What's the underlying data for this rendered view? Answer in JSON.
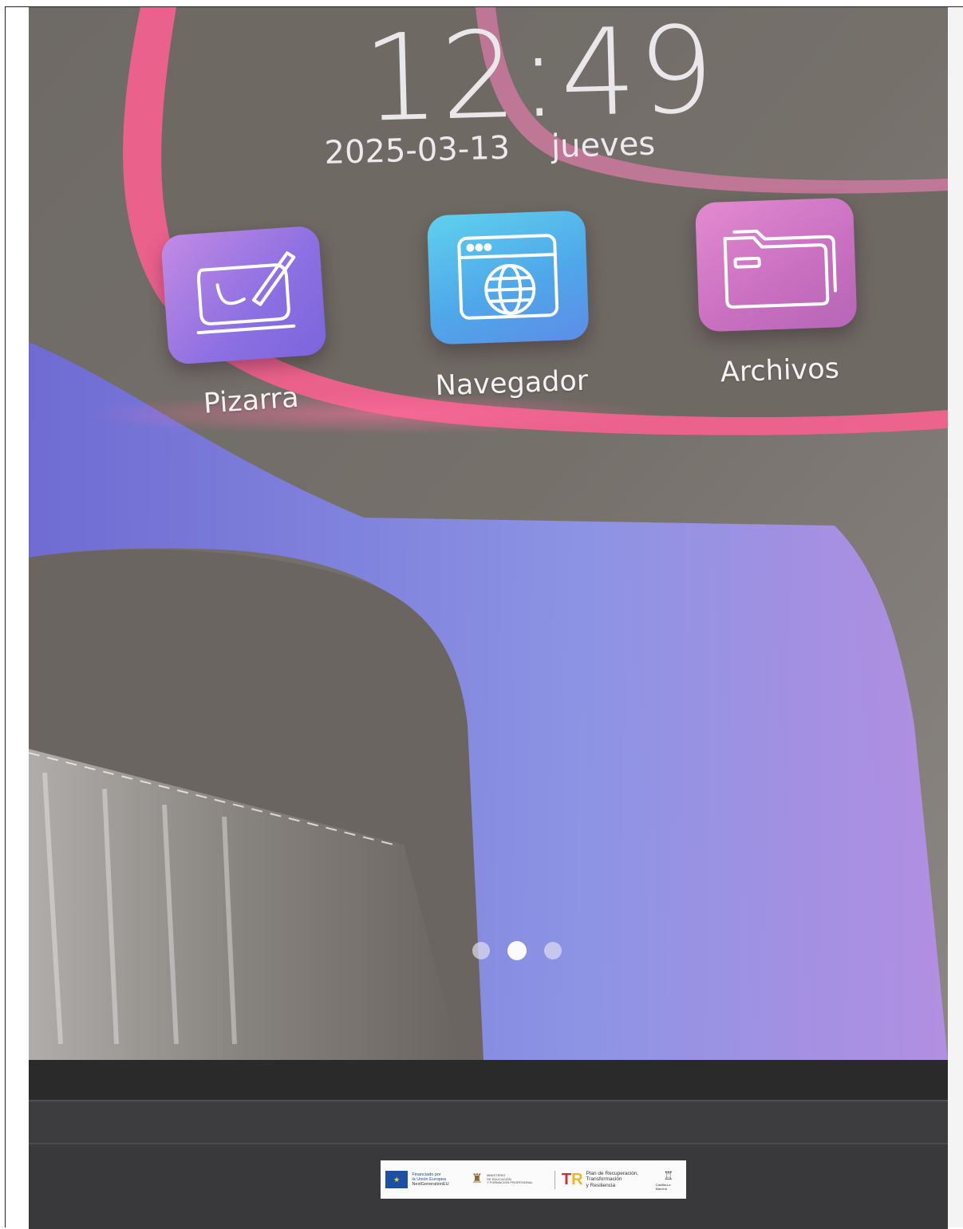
{
  "lock_screen": {
    "time": "12:49",
    "date": "2025-03-13",
    "weekday": "jueves"
  },
  "apps": [
    {
      "label": "Pizarra",
      "icon": "whiteboard-pen-icon"
    },
    {
      "label": "Navegador",
      "icon": "browser-globe-icon"
    },
    {
      "label": "Archivos",
      "icon": "folder-icon"
    }
  ],
  "page_indicator": {
    "total": 3,
    "active_index": 1
  },
  "sticker": {
    "eu_line1": "Financiado por",
    "eu_line2": "la Unión Europea",
    "eu_line3": "NextGenerationEU",
    "ministry_line1": "MINISTERIO",
    "ministry_line2": "DE EDUCACIÓN",
    "ministry_line3": "Y FORMACIÓN PROFESIONAL",
    "prtr_line1": "Plan de Recuperación,",
    "prtr_line2": "Transformación",
    "prtr_line3": "y Resiliencia",
    "region": "Castilla-La Mancha"
  },
  "colors": {
    "wallpaper_base": "#6c6862",
    "neon_pink": "#ff5f93",
    "violet": "#8a86e6",
    "pizarra_tile": "#9a78e4",
    "navegador_tile": "#55b6ec",
    "archivos_tile": "#d27ac8"
  }
}
